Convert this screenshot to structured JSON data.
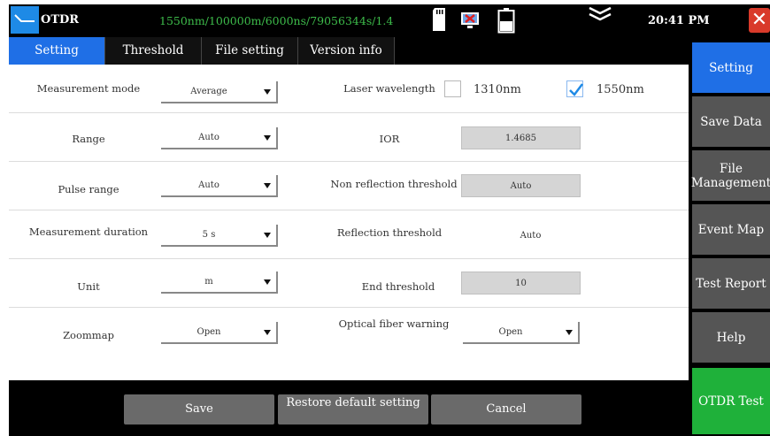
{
  "topbar": {
    "app_name": "OTDR",
    "status": "1550nm/100000m/6000ns/79056344s/1.4",
    "time": "20:41 PM",
    "icons": [
      "sd-card-icon",
      "network-icon",
      "battery-icon",
      "chevron-down-icon",
      "close-icon"
    ]
  },
  "tabs": [
    {
      "label": "Setting",
      "active": true
    },
    {
      "label": "Threshold setting",
      "active": false
    },
    {
      "label": "File setting",
      "active": false
    },
    {
      "label": "Version info",
      "active": false
    }
  ],
  "form": {
    "measurement_mode": {
      "label": "Measurement mode",
      "value": "Average"
    },
    "laser_wavelength": {
      "label": "Laser wavelength",
      "options": [
        {
          "label": "1310nm",
          "checked": false
        },
        {
          "label": "1550nm",
          "checked": true
        }
      ]
    },
    "range": {
      "label": "Range",
      "value": "Auto"
    },
    "ior": {
      "label": "IOR",
      "value": "1.4685"
    },
    "pulse_range": {
      "label": "Pulse range",
      "value": "Auto"
    },
    "non_reflection_threshold": {
      "label": "Non reflection threshold",
      "value": "Auto"
    },
    "measurement_duration": {
      "label": "Measurement duration",
      "value": "5 s"
    },
    "reflection_threshold": {
      "label": "Reflection threshold",
      "value": "Auto"
    },
    "unit": {
      "label": "Unit",
      "value": "m"
    },
    "end_threshold": {
      "label": "End threshold",
      "value": "10"
    },
    "zoommap": {
      "label": "Zoommap",
      "value": "Open"
    },
    "optical_fiber_warning": {
      "label": "Optical fiber warning",
      "value": "Open"
    }
  },
  "bottom": {
    "save": "Save",
    "restore": "Restore default setting",
    "cancel": "Cancel"
  },
  "sidebar": [
    {
      "label": "Setting",
      "active": true
    },
    {
      "label": "Save Data"
    },
    {
      "label": "File Management"
    },
    {
      "label": "Event Map"
    },
    {
      "label": "Test Report"
    },
    {
      "label": "Help"
    },
    {
      "label": "OTDR Test",
      "accent": "#1fb13a"
    }
  ],
  "colors": {
    "accent": "#1f6fe6",
    "status_green": "#3dbb4a",
    "close_red": "#d93a2a",
    "test_green": "#1fb13a"
  }
}
